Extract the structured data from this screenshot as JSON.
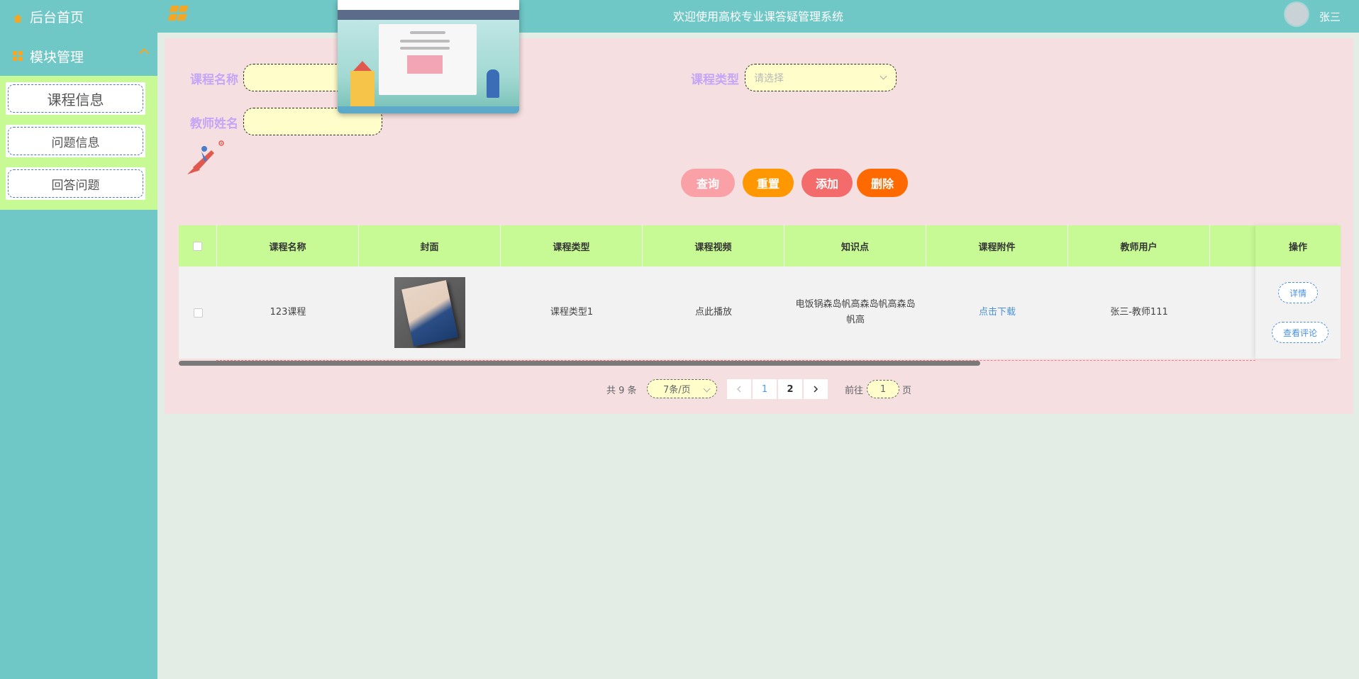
{
  "sidebar": {
    "home_label": "后台首页",
    "group_label": "模块管理",
    "items": [
      {
        "label": "课程信息"
      },
      {
        "label": "问题信息"
      },
      {
        "label": "回答问题"
      }
    ]
  },
  "header": {
    "title": "欢迎使用高校专业课答疑管理系统",
    "username": "张三"
  },
  "search": {
    "course_name_label": "课程名称",
    "course_name_value": "",
    "course_type_label": "课程类型",
    "course_type_placeholder": "请选择",
    "teacher_name_label": "教师姓名",
    "teacher_name_value": ""
  },
  "actions": {
    "query": "查询",
    "reset": "重置",
    "add": "添加",
    "delete": "删除"
  },
  "table": {
    "columns": [
      "课程名称",
      "封面",
      "课程类型",
      "课程视频",
      "知识点",
      "课程附件",
      "教师用户",
      "操作"
    ],
    "rows": [
      {
        "course_name": "123课程",
        "course_type": "课程类型1",
        "video": "点此播放",
        "knowledge": "电饭锅森岛帆高森岛帆高森岛帆高",
        "attachment": "点击下载",
        "teacher": "张三-教师111",
        "op_detail": "详情",
        "op_comment": "查看评论"
      }
    ]
  },
  "pagination": {
    "total": "共 9 条",
    "page_size": "7条/页",
    "pages": [
      "1",
      "2"
    ],
    "current_page": "1",
    "goto_label": "前往",
    "goto_value": "1",
    "page_suffix": "页"
  },
  "colors": {
    "sidebar_bg": "#6fc8c6",
    "accent_green": "#c7fa94",
    "panel_bg": "#f6dfe0",
    "query_btn": "#f9a1a6",
    "reset_btn": "#ff9800",
    "add_btn": "#f46b6b",
    "delete_btn": "#ff6a00"
  }
}
